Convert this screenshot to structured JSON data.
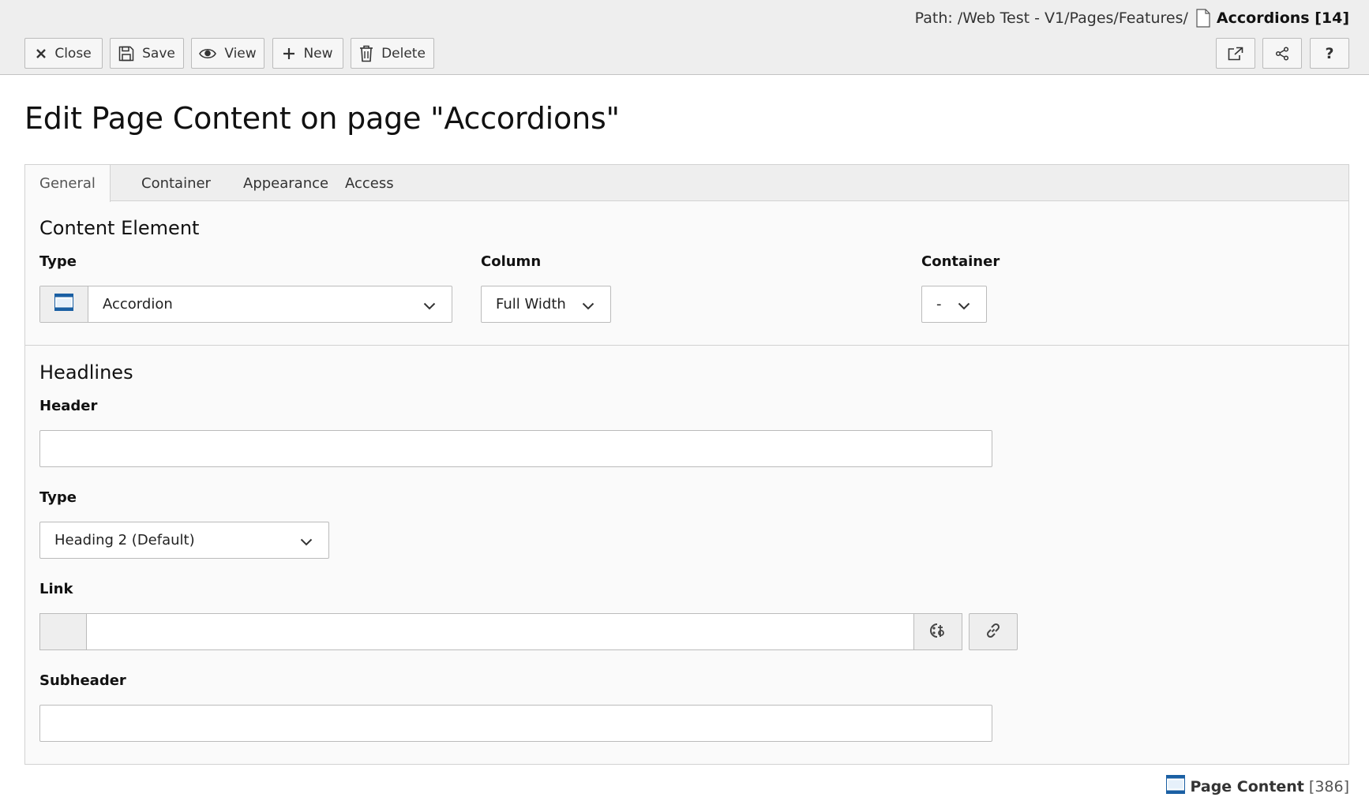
{
  "docheader": {
    "path_label": "Path: /Web Test - V1/Pages/Features/",
    "record_title": "Accordions [14]",
    "buttons": {
      "close": "Close",
      "save": "Save",
      "view": "View",
      "new": "New",
      "delete": "Delete"
    },
    "right_buttons": {
      "help": "?"
    }
  },
  "page_title": "Edit Page Content on page \"Accordions\"",
  "tabs": [
    "General",
    "Container",
    "Appearance",
    "Access"
  ],
  "active_tab": "General",
  "content_element": {
    "section_title": "Content Element",
    "type_label": "Type",
    "type_value": "Accordion",
    "column_label": "Column",
    "column_value": "Full Width",
    "container_label": "Container",
    "container_value": "-"
  },
  "headlines": {
    "section_title": "Headlines",
    "header_label": "Header",
    "header_value": "",
    "type_label": "Type",
    "type_value": "Heading 2 (Default)",
    "link_label": "Link",
    "link_value": "",
    "subheader_label": "Subheader",
    "subheader_value": ""
  },
  "footer": {
    "record_name": "Page Content",
    "record_id": "[386]"
  },
  "colors": {
    "docheader_bg": "#eeeeee",
    "accent_blue": "#1a5fa3"
  }
}
